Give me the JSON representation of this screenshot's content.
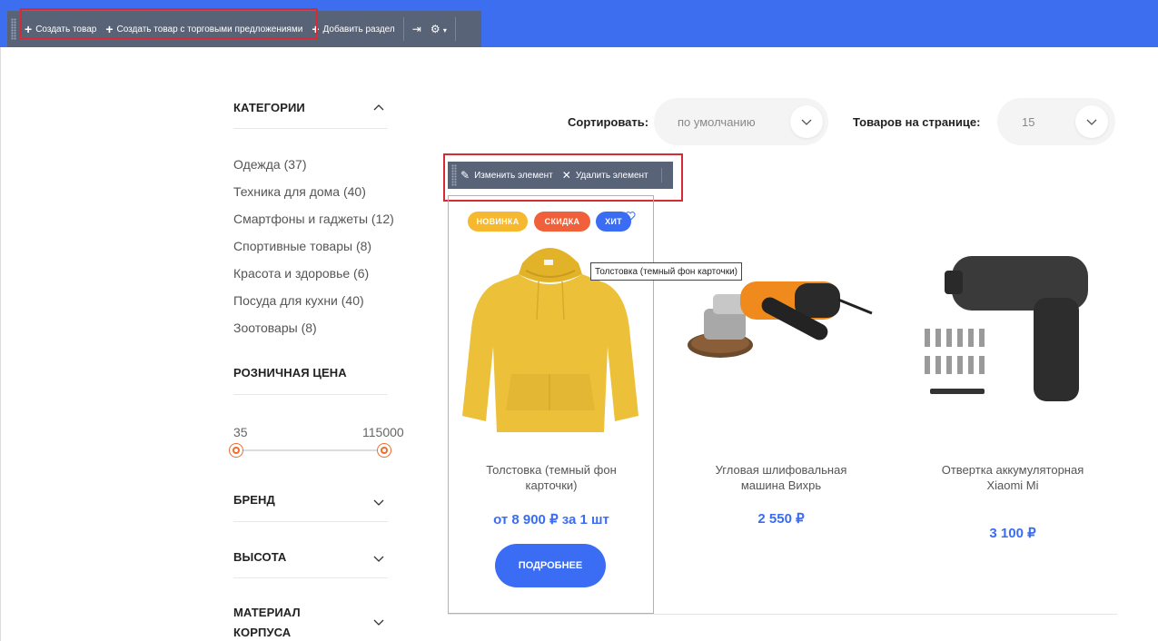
{
  "admin_toolbar": {
    "create_product": "Создать товар",
    "create_product_offers": "Создать товар с торговыми предложениями",
    "add_section": "Добавить раздел"
  },
  "filters": {
    "categories_title": "КАТЕГОРИИ",
    "categories": [
      "Одежда (37)",
      "Техника для дома (40)",
      "Смартфоны и гаджеты (12)",
      "Спортивные товары (8)",
      "Красота и здоровье (6)",
      "Посуда для кухни (40)",
      "Зоотовары (8)"
    ],
    "price_title": "РОЗНИЧНАЯ ЦЕНА",
    "price_min": "35",
    "price_max": "115000",
    "brand_title": "БРЕНД",
    "height_title": "ВЫСОТА",
    "material_title_line1": "МАТЕРИАЛ",
    "material_title_line2": "КОРПУСА"
  },
  "sorting": {
    "sort_label": "Сортировать:",
    "sort_value": "по умолчанию",
    "per_page_label": "Товаров на странице:",
    "per_page_value": "15"
  },
  "edit_toolbar": {
    "edit": "Изменить элемент",
    "delete": "Удалить элемент"
  },
  "products": [
    {
      "name": "Толстовка (темный фон карточки)",
      "price": "от 8 900 ₽ за 1 шт",
      "badges": [
        "НОВИНКА",
        "СКИДКА",
        "ХИТ"
      ],
      "tooltip": "Толстовка (темный фон карточки)",
      "button": "ПОДРОБНЕЕ"
    },
    {
      "name": "Угловая шлифовальная машина Вихрь",
      "price": "2 550 ₽"
    },
    {
      "name": "Отвертка аккумуляторная Xiaomi Mi",
      "price": "3 100 ₽"
    }
  ],
  "colors": {
    "topbar": "#3e6ef0",
    "admin_panel": "#596377",
    "highlight": "#d62a35",
    "accent_blue": "#3a6cf4",
    "badge_new": "#f5b82e",
    "badge_sale": "#f0603a",
    "badge_hit": "#3a6cf4",
    "range": "#f06c2b"
  }
}
